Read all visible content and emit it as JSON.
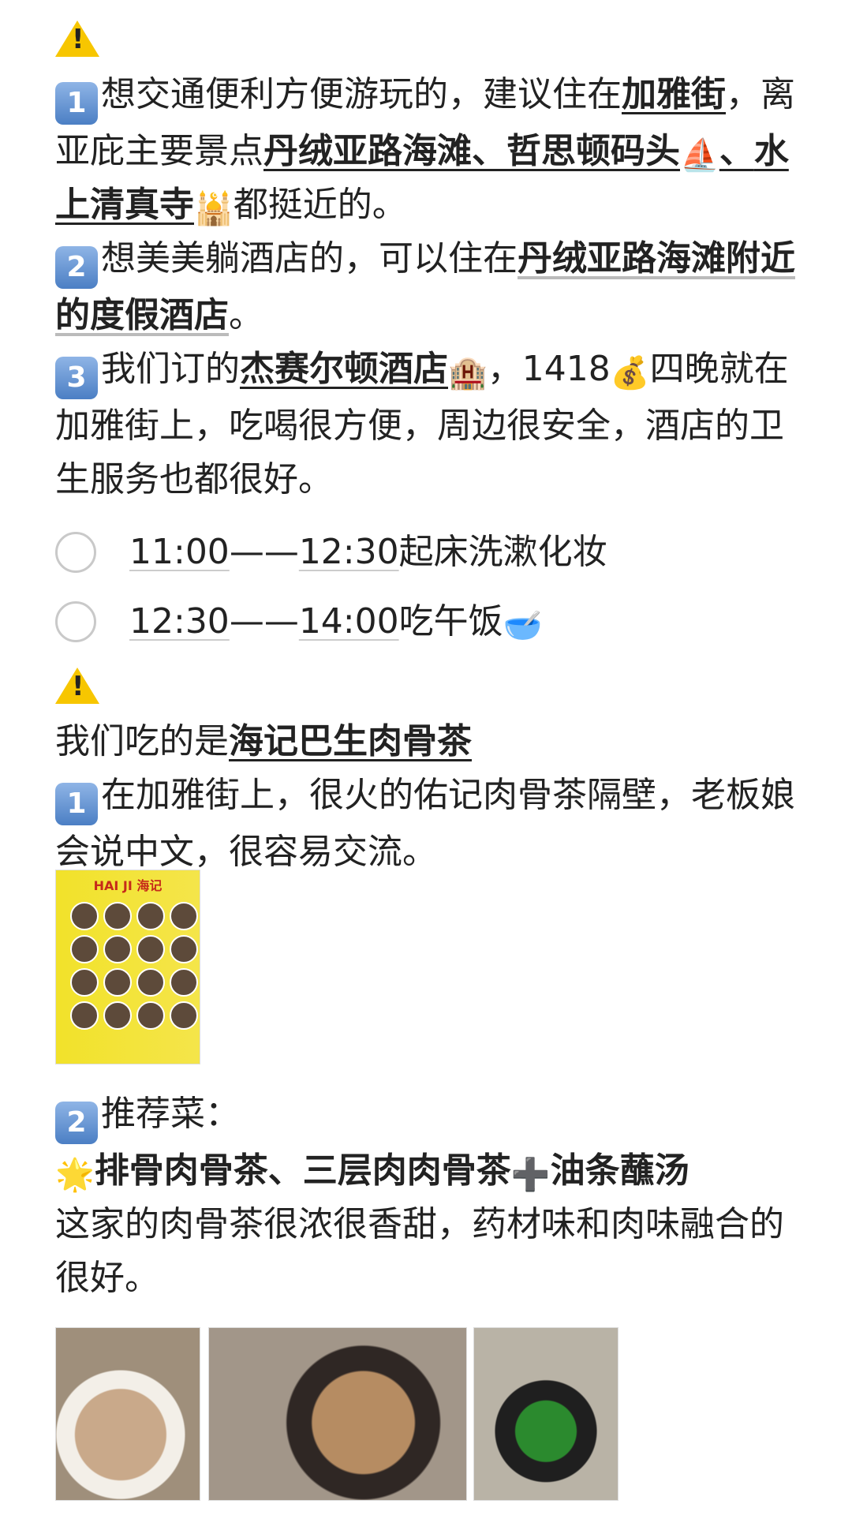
{
  "section1": {
    "p1_prefix": "想交通便利方便游玩的，建议住在",
    "p1_hl1": "加雅街",
    "p1_mid": "，离亚庇主要景点",
    "p1_hl2": "丹绒亚路海滩、哲思顿码头",
    "p1_hl3": "水上清真寺",
    "p1_suffix": "都挺近的。",
    "p2_prefix": "想美美躺酒店的，可以住在",
    "p2_hl": "丹绒亚路海滩附近的度假酒店",
    "p2_suffix": "。",
    "p3_prefix": "我们订的",
    "p3_hl": "杰赛尔顿酒店",
    "p3_mid": "，1418",
    "p3_suffix": "四晚就在加雅街上，吃喝很方便，周边很安全，酒店的卫生服务也都很好。"
  },
  "todos": [
    {
      "t1": "11:00",
      "dash": "——",
      "t2": "12:30",
      "label": "起床洗漱化妆"
    },
    {
      "t1": "12:30",
      "dash": "——",
      "t2": "14:00",
      "label": "吃午饭"
    }
  ],
  "section2": {
    "line1_prefix": "我们吃的是",
    "line1_hl": "海记巴生肉骨茶",
    "p1": "在加雅街上，很火的佑记肉骨茶隔壁，老板娘会说中文，很容易交流。",
    "menu_title": "HAI JI 海记",
    "p2_label": "推荐菜：",
    "star_line": "排骨肉骨茶、三层肉肉骨茶",
    "star_suffix": "油条蘸汤",
    "p3": "这家的肉骨茶很浓很香甜，药材味和肉味融合的很好。"
  },
  "numbers": [
    "1",
    "2",
    "3"
  ],
  "icons": {
    "warning": "warning-icon",
    "boat": "sailboat-icon",
    "mosque": "mosque-icon",
    "hotel": "hotel-icon",
    "money": "moneybag-icon",
    "bowl": "bowl-icon",
    "star": "star-icon",
    "plus": "plus-icon"
  }
}
